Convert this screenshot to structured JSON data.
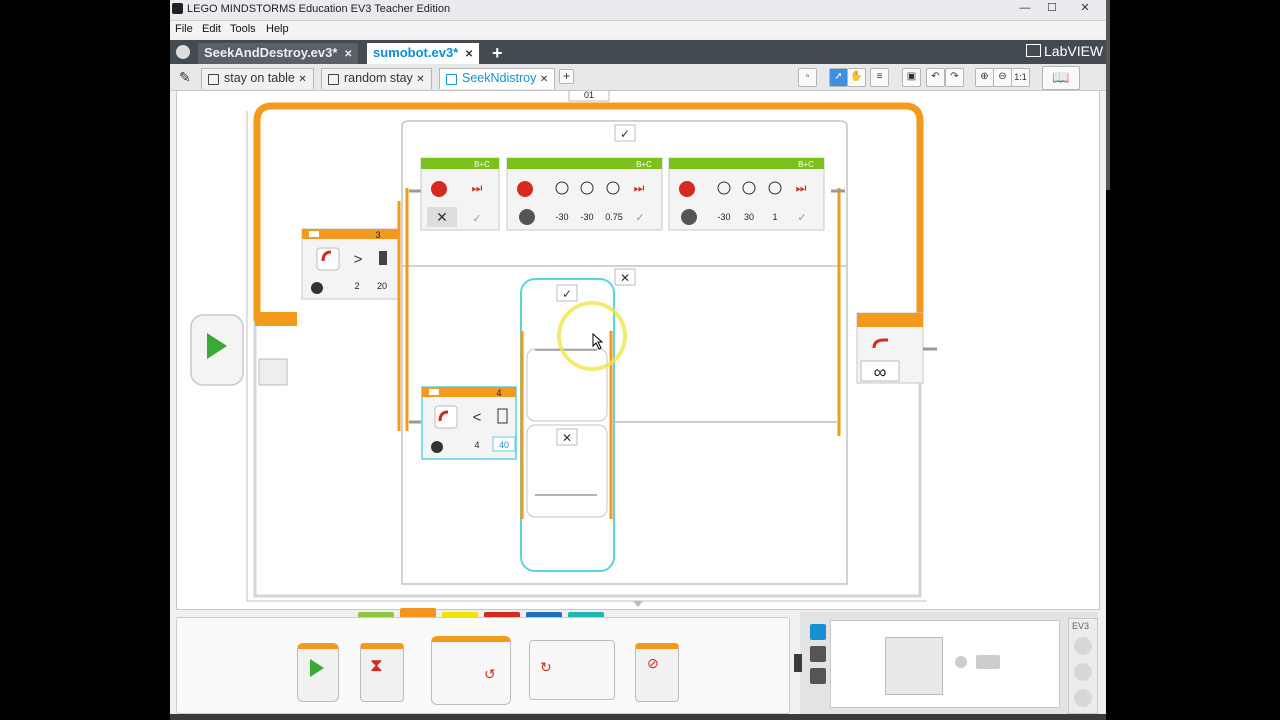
{
  "window": {
    "title": "LEGO MINDSTORMS Education EV3 Teacher Edition",
    "minimize": "—",
    "maximize": "☐",
    "close": "✕"
  },
  "menu": [
    "File",
    "Edit",
    "Tools",
    "Help"
  ],
  "projects": {
    "tabs": [
      {
        "label": "SeekAndDestroy.ev3*",
        "active": false
      },
      {
        "label": "sumobot.ev3*",
        "active": true
      }
    ],
    "close_glyph": "✕",
    "add_glyph": "+",
    "brand": "LabVIEW"
  },
  "programs": {
    "tabs": [
      {
        "label": "stay on table",
        "active": false
      },
      {
        "label": "random stay",
        "active": false
      },
      {
        "label": "SeekNdistroy",
        "active": true
      }
    ],
    "close_glyph": "✕",
    "add_glyph": "+",
    "zoom_label": "1:1"
  },
  "program": {
    "loop_label": "01",
    "switch_outer_port": "3",
    "switch_outer_compare": ">",
    "switch_outer_values": [
      "2",
      "20"
    ],
    "switch_inner_port": "4",
    "switch_inner_compare": "<",
    "switch_inner_values": [
      "4",
      "40"
    ],
    "motor_ports": "B+C",
    "move_block_2_values": [
      "-30",
      "-30",
      "0.75"
    ],
    "move_block_3_values": [
      "-30",
      "30",
      "1"
    ],
    "loop_infinity": "∞"
  },
  "colors": {
    "accent_orange": "#f39a1e",
    "accent_green": "#7dc11c",
    "accent_cyan": "#5bd3e0",
    "title_bar_dark": "#444a51"
  },
  "palette_colors": [
    "#8cc63f",
    "#f7941d",
    "#f2e500",
    "#d42a20",
    "#1d6fc4",
    "#21b5b5"
  ],
  "hardware": {
    "brick_label": "EV3"
  }
}
